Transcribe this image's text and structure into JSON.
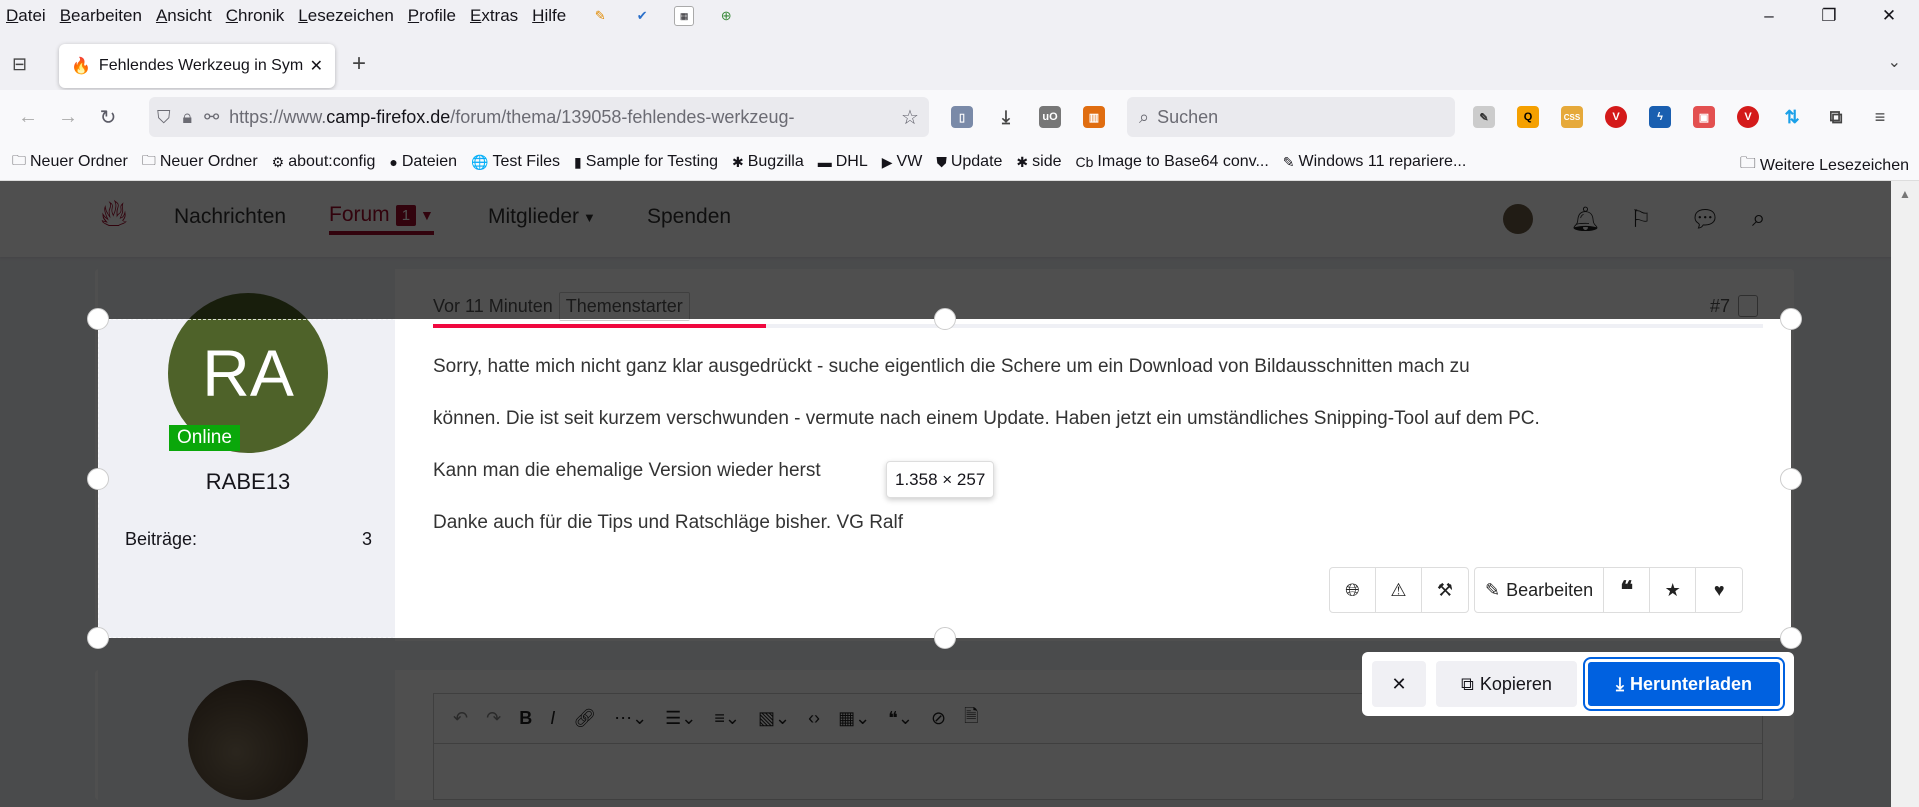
{
  "menubar": {
    "items": [
      "Datei",
      "Bearbeiten",
      "Ansicht",
      "Chronik",
      "Lesezeichen",
      "Profile",
      "Extras",
      "Hilfe"
    ]
  },
  "tab": {
    "title": "Fehlendes Werkzeug in Sym"
  },
  "navbar": {
    "url_prefix": "https://www.",
    "url_host": "camp-firefox.de",
    "url_path": "/forum/thema/139058-fehlendes-werkzeug-",
    "search_placeholder": "Suchen"
  },
  "bookmarks": {
    "items": [
      {
        "label": "Neuer Ordner",
        "icon": "folder-icon",
        "glyph": "🗀"
      },
      {
        "label": "Neuer Ordner",
        "icon": "folder-icon",
        "glyph": "🗀"
      },
      {
        "label": "about:config",
        "icon": "gear-icon",
        "glyph": "⚙"
      },
      {
        "label": "Dateien",
        "icon": "firefox-icon",
        "glyph": "●"
      },
      {
        "label": "Test Files",
        "icon": "globe-icon",
        "glyph": "🌐"
      },
      {
        "label": "Sample for Testing",
        "icon": "doc-icon",
        "glyph": "▮"
      },
      {
        "label": "Bugzilla",
        "icon": "bug-icon",
        "glyph": "✱"
      },
      {
        "label": "DHL",
        "icon": "dhl-icon",
        "glyph": "▬"
      },
      {
        "label": "VW",
        "icon": "youtube-icon",
        "glyph": "▶"
      },
      {
        "label": "Update",
        "icon": "ublock-icon",
        "glyph": "⛊"
      },
      {
        "label": "side",
        "icon": "bug-icon",
        "glyph": "✱"
      },
      {
        "label": "Image to Base64 conv...",
        "icon": "cb-icon",
        "glyph": "Cb"
      },
      {
        "label": "Windows 11 repariere...",
        "icon": "pen-icon",
        "glyph": "✎"
      }
    ],
    "more": "Weitere Lesezeichen"
  },
  "forum": {
    "nav": [
      "Nachrichten",
      "Forum",
      "Mitglieder",
      "Spenden"
    ],
    "forum_badge": "1"
  },
  "post": {
    "time": "Vor 11 Minuten",
    "badge": "Themenstarter",
    "number": "#7",
    "progress": 0.25,
    "author": {
      "initials": "RA",
      "status": "Online",
      "name": "RABE13",
      "posts_label": "Beiträge:",
      "posts": "3"
    },
    "paragraphs": [
      "Sorry, hatte mich nicht ganz klar ausgedrückt - suche eigentlich die Schere um ein Download von Bildausschnitten mach zu",
      "können. Die ist seit kurzem verschwunden - vermute nach einem Update. Haben jetzt ein umständliches Snipping-Tool auf dem PC.",
      "Kann man die ehemalige Version wieder herst",
      "Danke auch für die Tips und Ratschläge bisher. VG Ralf"
    ],
    "edit_label": "Bearbeiten"
  },
  "screenshot": {
    "dimensions": "1.358 × 257",
    "copy_label": "Kopieren",
    "download_label": "Herunterladen"
  },
  "colors": {
    "accent": "#a10a2a",
    "download": "#0061e0",
    "online": "#0aa70a",
    "progress": "#f0083f"
  }
}
